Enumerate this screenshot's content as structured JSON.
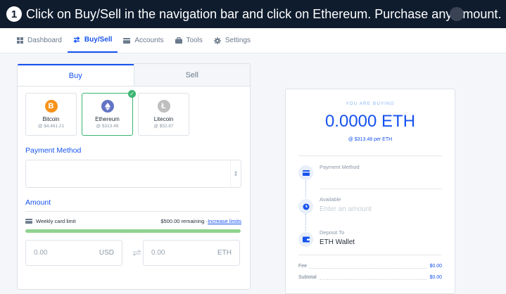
{
  "banner": {
    "step": "1",
    "instruction": "Click on Buy/Sell in the navigation bar and click on Ethereum. Purchase any amount."
  },
  "nav": {
    "items": [
      {
        "label": "Dashboard",
        "icon": "dashboard-icon"
      },
      {
        "label": "Buy/Sell",
        "icon": "swap-arrows-icon",
        "active": true
      },
      {
        "label": "Accounts",
        "icon": "wallet-icon"
      },
      {
        "label": "Tools",
        "icon": "toolbox-icon"
      },
      {
        "label": "Settings",
        "icon": "gear-icon"
      }
    ]
  },
  "trade": {
    "tabs": {
      "buy": "Buy",
      "sell": "Sell"
    },
    "coins": [
      {
        "name": "Bitcoin",
        "price": "@ $4,461.21",
        "color": "#f7931a",
        "symbol": "B"
      },
      {
        "name": "Ethereum",
        "price": "@ $313.48",
        "color": "#6274c4",
        "symbol": "◆",
        "selected": true
      },
      {
        "name": "Litecoin",
        "price": "@ $52.87",
        "color": "#bfbfbf",
        "symbol": "Ł"
      }
    ],
    "payment_method_label": "Payment Method",
    "payment_method_value": "",
    "amount_label": "Amount",
    "limit": {
      "label": "Weekly card limit",
      "remaining": "$500.00 remaining · ",
      "link": "Increase limits",
      "fraction_used": 0.0
    },
    "usd_amount": "0.00",
    "usd_unit": "USD",
    "eth_amount": "0.00",
    "eth_unit": "ETH"
  },
  "summary": {
    "you_are_buying": "YOU ARE BUYING",
    "amount": "0.0000 ETH",
    "rate": "@ $313.48 per ETH",
    "payment_method_label": "Payment Method",
    "available_label": "Available",
    "available_placeholder": "Enter an amount",
    "deposit_label": "Deposit To",
    "deposit_value": "ETH Wallet",
    "fee_label": "Fee",
    "fee_value": "$0.00",
    "subtotal_label": "Subtotal",
    "subtotal_value": "$0.00"
  },
  "colors": {
    "accent": "#1652f0",
    "success": "#3ab56f",
    "banner_bg": "#0f1c2e"
  }
}
